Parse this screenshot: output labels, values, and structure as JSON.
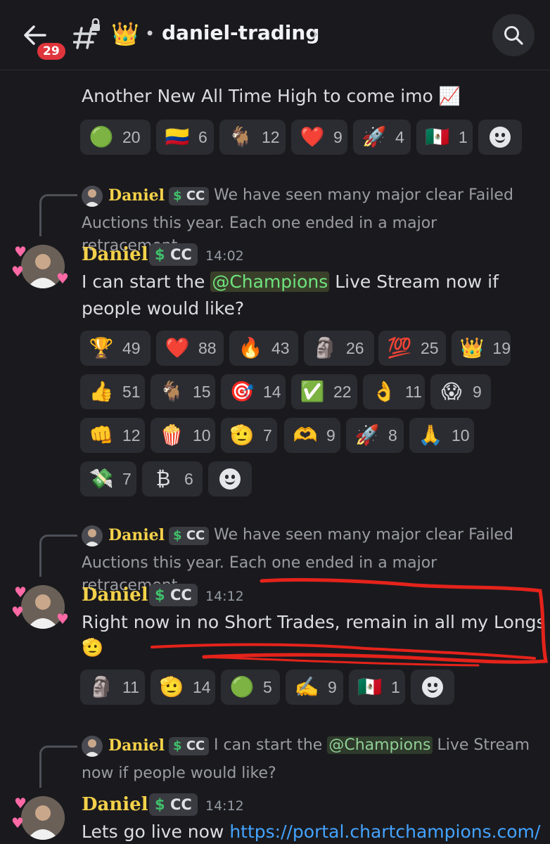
{
  "header": {
    "back_badge": "29",
    "crown": "👑",
    "dot": "•",
    "channel": "daniel-trading",
    "chevron": "›"
  },
  "msg0": {
    "text": "Another New All Time High to come imo 📈",
    "reactions": [
      {
        "emoji": "🟢",
        "count": "20"
      },
      {
        "emoji": "🇨🇴",
        "count": "6"
      },
      {
        "emoji": "🐐",
        "count": "12"
      },
      {
        "emoji": "❤️",
        "count": "9"
      },
      {
        "emoji": "🚀",
        "count": "4"
      },
      {
        "emoji": "🇲🇽",
        "count": "1"
      }
    ]
  },
  "msg1": {
    "reply_name": "Daniel",
    "reply_tag": "CC",
    "reply_text_1": "We have seen many major clear Failed",
    "reply_text_2": "Auctions this year.   Each one ended in a major retracement…",
    "author": "Daniel",
    "tag": "CC",
    "time": "14:02",
    "text_pre": "I can start the ",
    "mention": "@Champions",
    "text_post": " Live Stream now if",
    "text_line2": "people would like?",
    "reactions": [
      {
        "emoji": "🏆",
        "count": "49"
      },
      {
        "emoji": "❤️",
        "count": "88"
      },
      {
        "emoji": "🔥",
        "count": "43"
      },
      {
        "emoji": "🗿",
        "count": "26"
      },
      {
        "emoji": "💯",
        "count": "25"
      },
      {
        "emoji": "👑",
        "count": "19"
      },
      {
        "emoji": "👍",
        "count": "51"
      },
      {
        "emoji": "🐐",
        "count": "15"
      },
      {
        "emoji": "🎯",
        "count": "14"
      },
      {
        "emoji": "✅",
        "count": "22"
      },
      {
        "emoji": "👌",
        "count": "11"
      },
      {
        "emoji": "😱",
        "count": "9"
      },
      {
        "emoji": "👊",
        "count": "12"
      },
      {
        "emoji": "🍿",
        "count": "10"
      },
      {
        "emoji": "🫡",
        "count": "7"
      },
      {
        "emoji": "🫶",
        "count": "9"
      },
      {
        "emoji": "🚀",
        "count": "8"
      },
      {
        "emoji": "🙏",
        "count": "10"
      },
      {
        "emoji": "💸",
        "count": "7"
      },
      {
        "emoji": "₿",
        "count": "6"
      }
    ]
  },
  "msg2": {
    "reply_name": "Daniel",
    "reply_tag": "CC",
    "reply_text_1": "We have seen many major clear Failed",
    "reply_text_2": "Auctions this year.   Each one ended in a major retracement…",
    "author": "Daniel",
    "tag": "CC",
    "time": "14:12",
    "text_line1": "Right now in no Short Trades, remain in all my Longs",
    "text_line2": "🫡",
    "reactions": [
      {
        "emoji": "🗿",
        "count": "11"
      },
      {
        "emoji": "🫡",
        "count": "14"
      },
      {
        "emoji": "🟢",
        "count": "5"
      },
      {
        "emoji": "✍️",
        "count": "9"
      },
      {
        "emoji": "🇲🇽",
        "count": "1"
      }
    ]
  },
  "msg3": {
    "reply_name": "Daniel",
    "reply_tag": "CC",
    "reply_pre": "I can start the ",
    "reply_mention": "@Champions",
    "reply_post": " Live Stream",
    "reply_text_2": "now if people would like?",
    "author": "Daniel",
    "tag": "CC",
    "time": "14:12",
    "text_pre": "Lets go live now ",
    "link": "https://portal.chartchampions.com/"
  },
  "colors": {
    "background": "#1a1a1e",
    "username": "#f4d14a",
    "mention": "#6ee37e",
    "link": "#44a3ff",
    "annotation": "#e5231b",
    "badge": "#e0353c"
  }
}
